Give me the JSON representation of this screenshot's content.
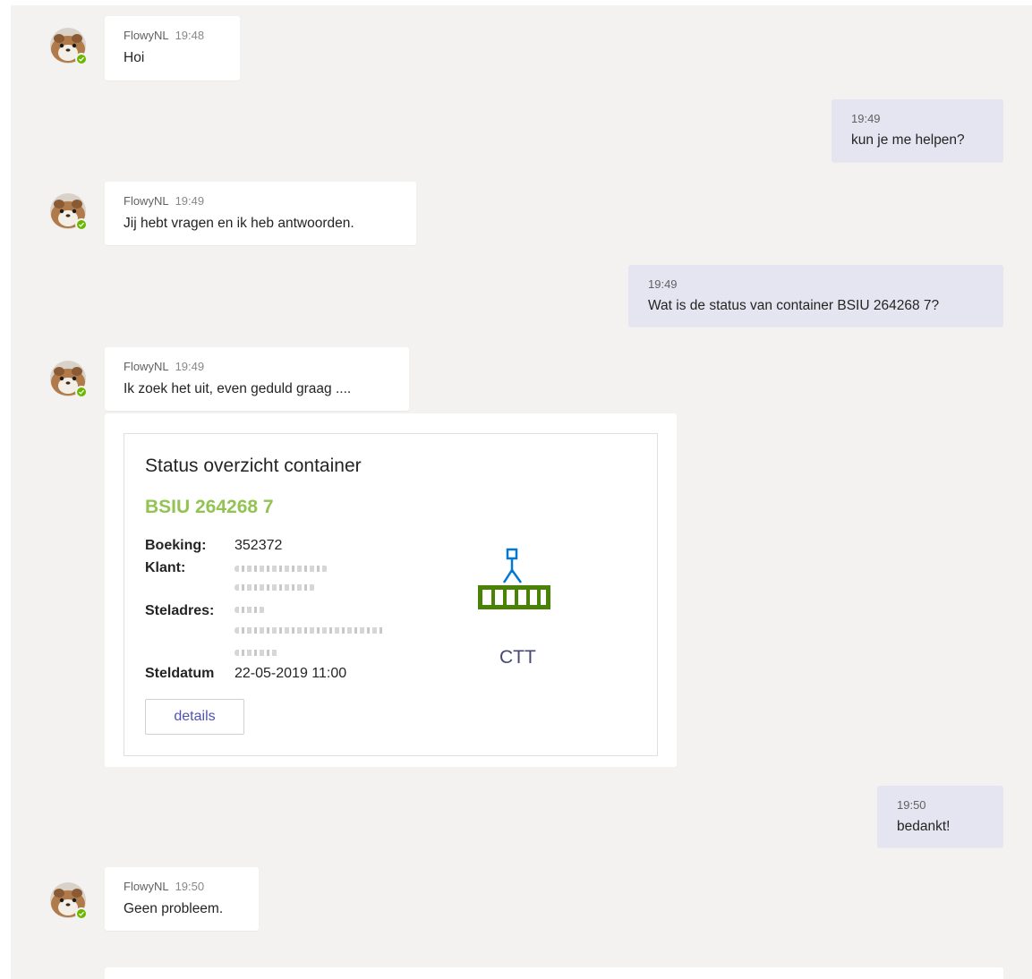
{
  "messages": [
    {
      "sender": "FlowyNL",
      "time": "19:48",
      "text": "Hoi"
    },
    {
      "time": "19:49",
      "text": "kun je me helpen?"
    },
    {
      "sender": "FlowyNL",
      "time": "19:49",
      "text": "Jij hebt vragen en ik heb antwoorden."
    },
    {
      "time": "19:49",
      "text": "Wat is de status van container BSIU 264268 7?"
    },
    {
      "sender": "FlowyNL",
      "time": "19:49",
      "text": "Ik zoek het uit, even geduld graag ...."
    },
    {
      "time": "19:50",
      "text": "bedankt!"
    },
    {
      "sender": "FlowyNL",
      "time": "19:50",
      "text": "Geen probleem."
    }
  ],
  "card": {
    "title": "Status overzicht container",
    "container_id": "BSIU 264268 7",
    "labels": {
      "booking": "Boeking:",
      "client": "Klant:",
      "address": "Steladres:",
      "date": "Steldatum"
    },
    "booking": "352372",
    "date": "22-05-2019 11:00",
    "button_label": "details",
    "logo_text": "CTT",
    "logo_icon": "container-crane-icon"
  },
  "colors": {
    "accent_green": "#92c353",
    "logo_green": "#498205",
    "logo_blue": "#0078d4",
    "button_text": "#4f52b2",
    "own_bubble": "#e5e5f1",
    "presence": "#6bb700"
  }
}
